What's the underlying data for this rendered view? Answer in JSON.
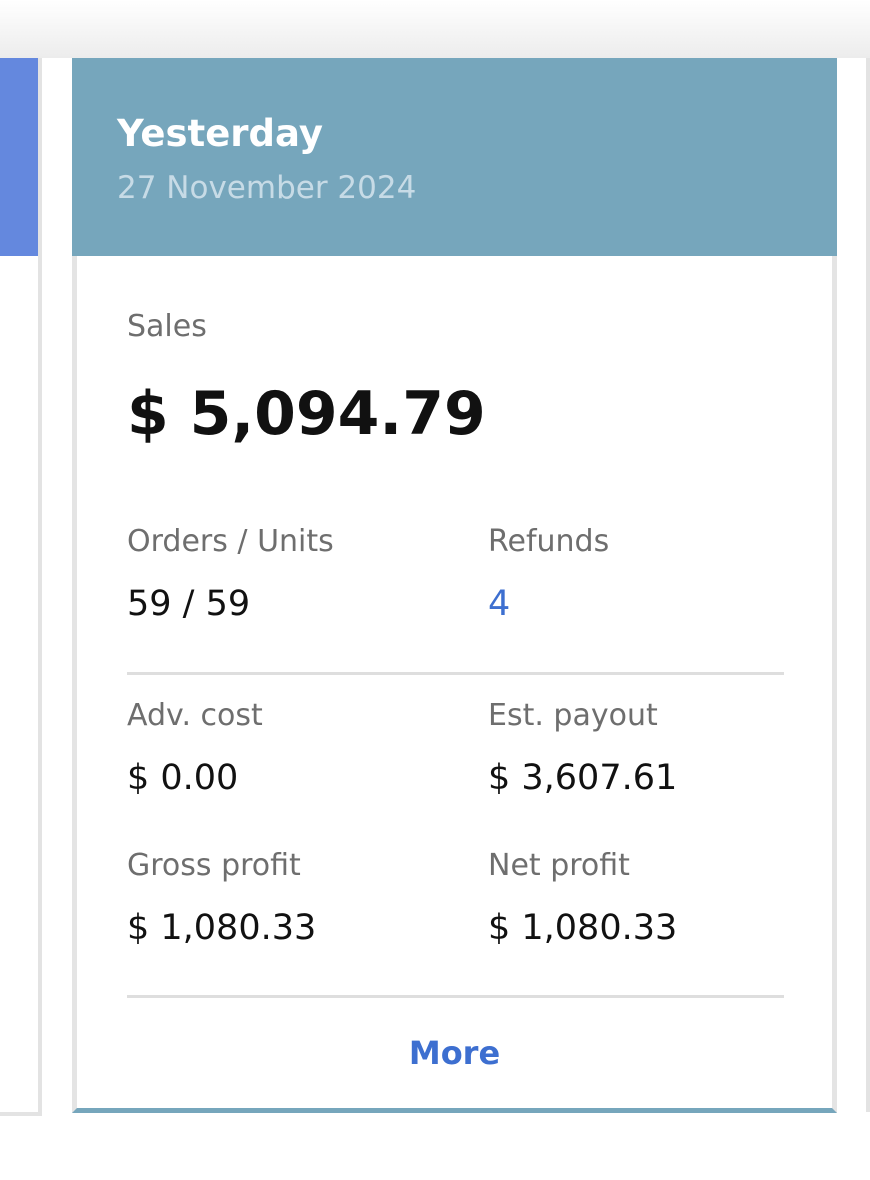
{
  "card": {
    "title": "Yesterday",
    "date": "27 November 2024",
    "sales": {
      "label": "Sales",
      "value": "$ 5,094.79"
    },
    "orders_units": {
      "label": "Orders / Units",
      "value": "59 / 59"
    },
    "refunds": {
      "label": "Refunds",
      "value": "4"
    },
    "adv_cost": {
      "label": "Adv. cost",
      "value": "$ 0.00"
    },
    "est_payout": {
      "label": "Est. payout",
      "value": "$ 3,607.61"
    },
    "gross_profit": {
      "label": "Gross profit",
      "value": "$ 1,080.33"
    },
    "net_profit": {
      "label": "Net profit",
      "value": "$ 1,080.33"
    },
    "more_label": "More"
  },
  "colors": {
    "card_header": "#76a6bc",
    "left_card_header": "#6488de",
    "right_card_header": "#4e9e9a",
    "link": "#3d6fd0"
  }
}
